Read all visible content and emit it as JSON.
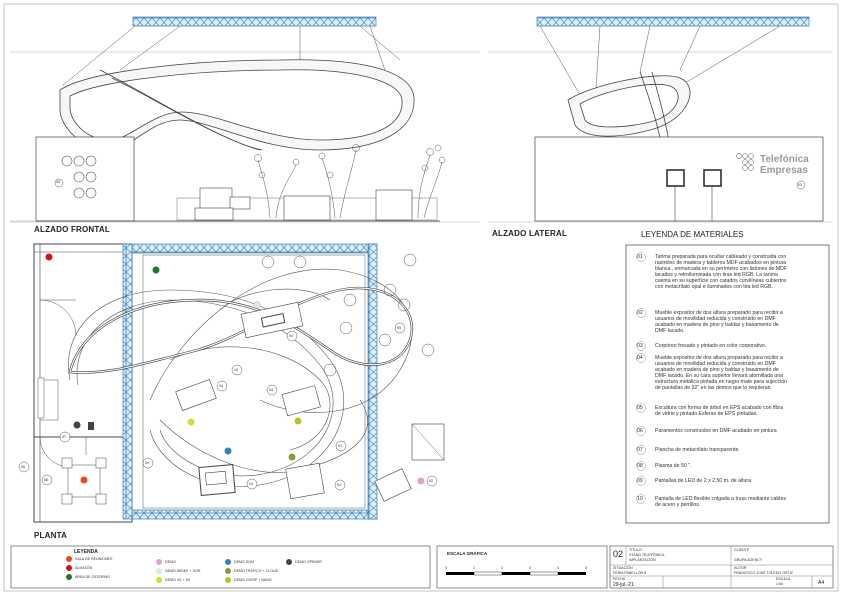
{
  "views": {
    "front_title": "ALZADO FRONTAL",
    "side_title": "ALZADO LATERAL",
    "plan_title": "PLANTA",
    "brand_line1": "Telefónica",
    "brand_line2": "Empresas"
  },
  "tags": {
    "front_03": "03",
    "side_03": "03",
    "plan_04a": "04",
    "plan_04b": "04",
    "plan_04c": "04",
    "plan_04d": "04",
    "plan_04e": "04",
    "plan_05": "05",
    "plan_10": "10",
    "plan_01": "01",
    "plan_07": "07",
    "plan_08": "08",
    "plan_09": "09",
    "plan_02": "02",
    "plan_06": "06"
  },
  "materials": {
    "title": "LEYENDA DE MATERIALES",
    "items": [
      {
        "num": "01",
        "lines": [
          "Tarima preparada para ocultar cableado y construida con",
          "rastreles de madera y tableros MDF acabados en pintura",
          "blanca , enmarcada en su perímetro con listones de MDF",
          "lacados y retroiluminada con tiras led RGB. La tarima",
          "cuenta en su superficie con catados curvilíneas cubiertos",
          "con metacrilato opal e iluminados con tira led RGB."
        ]
      },
      {
        "num": "02",
        "lines": [
          "Mueble expositor de dos altura preparado para recibir a",
          "usuarios de movilidad reducida y construido en DMF",
          "acabado en  madera de pino y baldas y basamento de",
          "DMF lacado."
        ]
      },
      {
        "num": "03",
        "lines": [
          "Corpóreo fresado y pintado en color corporativo."
        ]
      },
      {
        "num": "04",
        "lines": [
          "Mueble expositor de dos altura preparado para recibir a",
          "usuarios de movilidad reducida y construido en DMF",
          "acabado en  madera de pino y baldas y basamento de",
          "DMF lacado. En su cara superior llevará atornillada una",
          "estructura metálica pintada en negro mate para sujección",
          "de pantallas de 32\" en las demos que lo requieran."
        ]
      },
      {
        "num": "05",
        "lines": [
          "Escultura con forma de árbol en EPS acabado con fibra",
          "de vidrio y pintado.Esferas de EPS pintadas."
        ]
      },
      {
        "num": "06",
        "lines": [
          "Paramentos  construidos en DMF acabado en pintura"
        ]
      },
      {
        "num": "07",
        "lines": [
          "Plancha de metacrilato transparente."
        ]
      },
      {
        "num": "08",
        "lines": [
          "Plasma de 50 \"."
        ]
      },
      {
        "num": "09",
        "lines": [
          "Pantallas de LED de 2 x 2,50 m.  de altura"
        ]
      },
      {
        "num": "10",
        "lines": [
          "Pantalla de LED flexible colgada a truss mediante cables",
          "de acero y perrillos."
        ]
      }
    ]
  },
  "legend": {
    "title": "LEYENDA",
    "items": [
      {
        "label": "SALA DE REUNIONES",
        "color": "#e8491d"
      },
      {
        "label": "ALMACÉN",
        "color": "#d0121b"
      },
      {
        "label": "ÁREA DE CATERING",
        "color": "#1a7a2a"
      },
      {
        "label": "DEMO",
        "color": "#e3a3cf"
      },
      {
        "label": "DEMO WIDEE + SOR",
        "color": "#d8ecd8"
      },
      {
        "label": "DEMO 4G + 5G",
        "color": "#d4db3a"
      },
      {
        "label": "DEMO SOM",
        "color": "#2e86c1"
      },
      {
        "label": "DEMO TRÁFICO + CLOUD",
        "color": "#8a9a3a"
      },
      {
        "label": "DEMO OGSIP + NANO",
        "color": "#b9c22a"
      },
      {
        "label": "DEMO OPENER",
        "color": "#444444"
      }
    ]
  },
  "scale": {
    "title": "ESCALA GRÁFICA",
    "ticks": [
      "0",
      "1",
      "2",
      "3",
      "4",
      "5"
    ]
  },
  "titleblock": {
    "sheet_num": "02",
    "label_title": "TÍTULO",
    "title_line1": "STAND TELEFÓNICA",
    "title_line2": "IMPLANTACIÓN",
    "label_location": "SITUACIÓN",
    "location": "FERIA PABELLÓN 6",
    "label_date": "FECHA",
    "date": "29-jul.-21",
    "label_client": "CLIENTE",
    "client": "GRUPA AGENCY",
    "label_author": "AUTOR",
    "author": "FRANCISCO JOSÉ TOLEDO ORTIZ",
    "label_scale": "ESCALA",
    "scale_value": "1:60",
    "paper": "A4"
  }
}
